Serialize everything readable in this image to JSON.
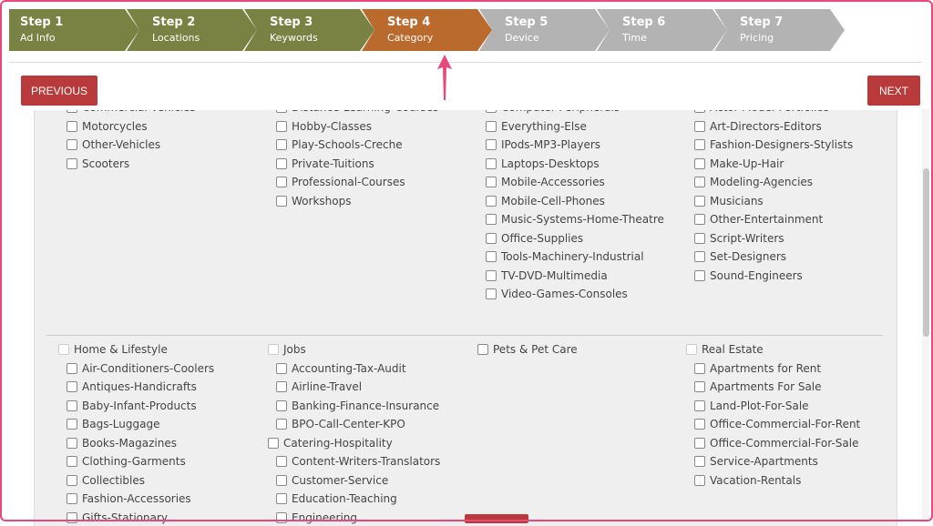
{
  "steps": [
    {
      "title": "Step 1",
      "sub": "Ad Info",
      "state": "done"
    },
    {
      "title": "Step 2",
      "sub": "Locations",
      "state": "done"
    },
    {
      "title": "Step 3",
      "sub": "Keywords",
      "state": "done"
    },
    {
      "title": "Step 4",
      "sub": "Category",
      "state": "active"
    },
    {
      "title": "Step 5",
      "sub": "Device",
      "state": "todo"
    },
    {
      "title": "Step 6",
      "sub": "Time",
      "state": "todo"
    },
    {
      "title": "Step 7",
      "sub": "Pricing",
      "state": "todo"
    }
  ],
  "colors": {
    "done": "#7a8243",
    "active": "#bb6a2d",
    "todo": "#b3b3b3",
    "button": "#b93a3a",
    "highlight": "#e8497a"
  },
  "buttons": {
    "previous": "PREVIOUS",
    "next": "NEXT"
  },
  "top_section": [
    {
      "items": [
        "Commercial-Vehicles",
        "Motorcycles",
        "Other-Vehicles",
        "Scooters"
      ]
    },
    {
      "items": [
        "Distance-Learning-Courses",
        "Hobby-Classes",
        "Play-Schools-Creche",
        "Private-Tuitions",
        "Professional-Courses",
        "Workshops"
      ]
    },
    {
      "items": [
        "Computer-Peripherals",
        "Everything-Else",
        "IPods-MP3-Players",
        "Laptops-Desktops",
        "Mobile-Accessories",
        "Mobile-Cell-Phones",
        "Music-Systems-Home-Theatre",
        "Office-Supplies",
        "Tools-Machinery-Industrial",
        "TV-DVD-Multimedia",
        "Video-Games-Consoles"
      ]
    },
    {
      "items": [
        "Actor-Model-Portfolios",
        "Art-Directors-Editors",
        "Fashion-Designers-Stylists",
        "Make-Up-Hair",
        "Modeling-Agencies",
        "Musicians",
        "Other-Entertainment",
        "Script-Writers",
        "Set-Designers",
        "Sound-Engineers"
      ]
    }
  ],
  "bottom_section": [
    {
      "heading": "Home & Lifestyle",
      "items": [
        "Air-Conditioners-Coolers",
        "Antiques-Handicrafts",
        "Baby-Infant-Products",
        "Bags-Luggage",
        "Books-Magazines",
        "Clothing-Garments",
        "Collectibles",
        "Fashion-Accessories",
        "Gifts-Stationary"
      ]
    },
    {
      "heading": "Jobs",
      "items": [
        "Accounting-Tax-Audit",
        "Airline-Travel",
        "Banking-Finance-Insurance",
        "BPO-Call-Center-KPO",
        "Catering-Hospitality",
        "Content-Writers-Translators",
        "Customer-Service",
        "Education-Teaching",
        "Engineering"
      ]
    },
    {
      "heading": "Pets & Pet Care",
      "items": []
    },
    {
      "heading": "Real Estate",
      "items": [
        "Apartments for Rent",
        "Apartments For Sale",
        "Land-Plot-For-Sale",
        "Office-Commercial-For-Rent",
        "Office-Commercial-For-Sale",
        "Service-Apartments",
        "Vacation-Rentals"
      ]
    }
  ]
}
